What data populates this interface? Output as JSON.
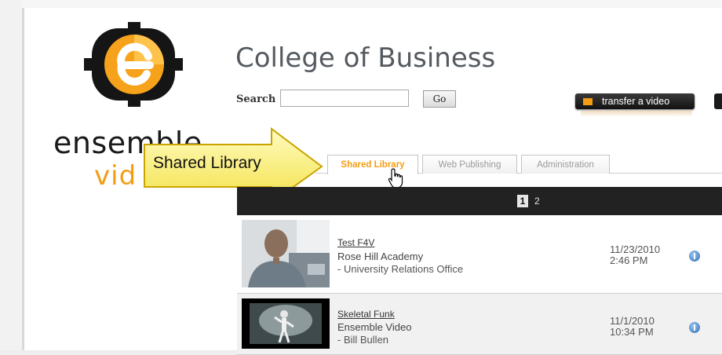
{
  "logo": {
    "word": "ensemble",
    "sub": "vid",
    "icon_name": "ensemble-e-logo-icon",
    "accent": "#f39c12"
  },
  "header": {
    "title": "College of Business"
  },
  "search": {
    "label": "Search",
    "value": "",
    "placeholder": "",
    "go_label": "Go"
  },
  "toolbar": {
    "transfer_label": "transfer a video"
  },
  "tabs": [
    {
      "label": "Shared Library",
      "active": true
    },
    {
      "label": "Web Publishing",
      "active": false
    },
    {
      "label": "Administration",
      "active": false
    }
  ],
  "callout": {
    "text": "Shared Library"
  },
  "pager": {
    "current": "1",
    "next": "2"
  },
  "videos": [
    {
      "title": "Test F4V",
      "owner": "Rose Hill Academy",
      "dept": "- University Relations Office",
      "date": "11/23/2010",
      "time": "2:46 PM"
    },
    {
      "title": "Skeletal Funk",
      "owner": "Ensemble Video",
      "dept": "- Bill Bullen",
      "date": "11/1/2010",
      "time": "10:34 PM"
    }
  ]
}
